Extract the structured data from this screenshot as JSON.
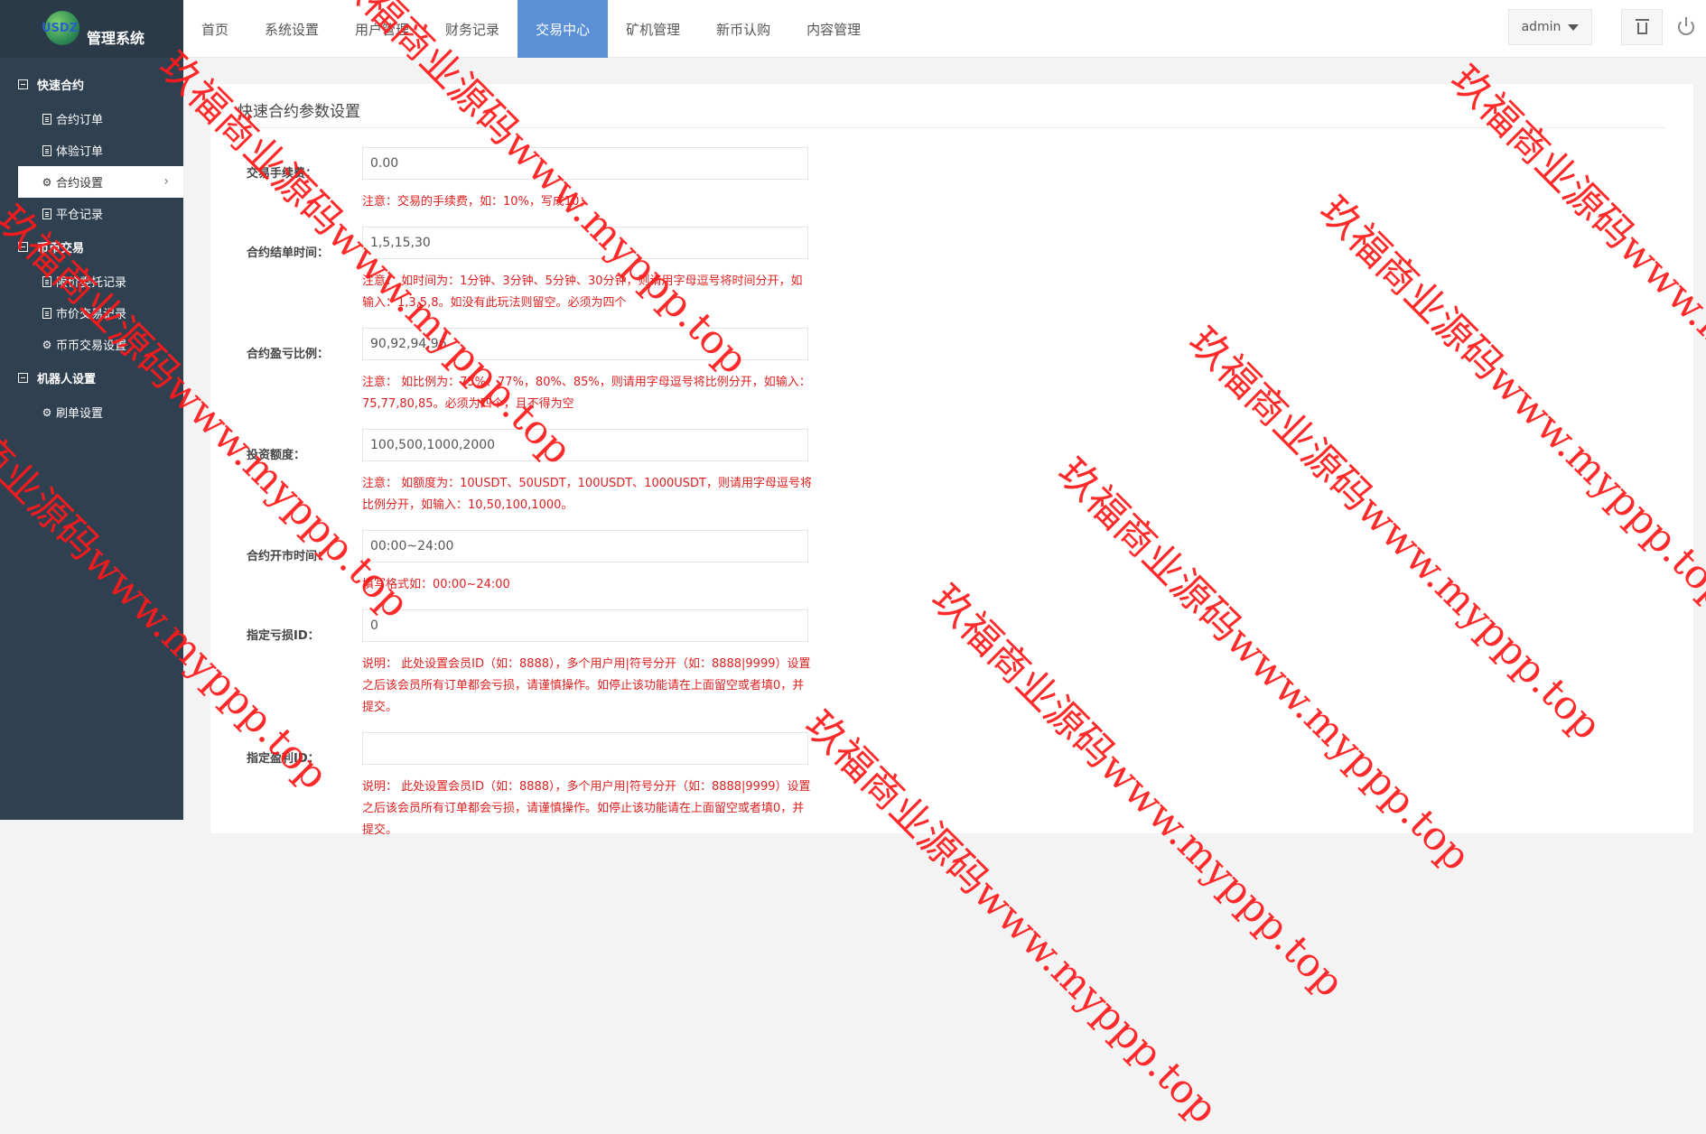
{
  "brand": {
    "logo_mark": "USDZ",
    "title": "管理系统"
  },
  "sidebar": {
    "groups": [
      {
        "title": "快速合约",
        "items": [
          {
            "label": "合约订单",
            "icon": "doc"
          },
          {
            "label": "体验订单",
            "icon": "doc"
          },
          {
            "label": "合约设置",
            "icon": "gear",
            "active": true
          },
          {
            "label": "平仓记录",
            "icon": "doc"
          }
        ]
      },
      {
        "title": "币币交易",
        "items": [
          {
            "label": "限价委托记录",
            "icon": "doc"
          },
          {
            "label": "市价交易记录",
            "icon": "doc"
          },
          {
            "label": "币币交易设置",
            "icon": "gear"
          }
        ]
      },
      {
        "title": "机器人设置",
        "items": [
          {
            "label": "刷单设置",
            "icon": "gear"
          }
        ]
      }
    ]
  },
  "topnav": {
    "items": [
      "首页",
      "系统设置",
      "用户管理",
      "财务记录",
      "交易中心",
      "矿机管理",
      "新币认购",
      "内容管理"
    ],
    "active_index": 4
  },
  "header": {
    "user": "admin"
  },
  "panel": {
    "title": "快速合约参数设置",
    "fields": [
      {
        "label": "交易手续费：",
        "value": "0.00",
        "note": "注意：交易的手续费，如：10%，写成10；"
      },
      {
        "label": "合约结单时间：",
        "value": "1,5,15,30",
        "note": "注意：  如时间为：1分钟、3分钟、5分钟、30分钟，则请用字母逗号将时间分开，如输入：1,3,5,8。如没有此玩法则留空。必须为四个"
      },
      {
        "label": "合约盈亏比例：",
        "value": "90,92,94,96",
        "note": "注意：  如比例为：75%、77%，80%、85%，则请用字母逗号将比例分开，如输入：75,77,80,85。必须为四个，且不得为空"
      },
      {
        "label": "投资额度：",
        "value": "100,500,1000,2000",
        "note": "注意：  如额度为：10USDT、50USDT，100USDT、1000USDT，则请用字母逗号将比例分开，如输入：10,50,100,1000。"
      },
      {
        "label": "合约开市时间：",
        "value": "00:00~24:00",
        "note": "填写格式如：00:00~24:00"
      },
      {
        "label": "指定亏损ID：",
        "value": "0",
        "note": "说明：  此处设置会员ID（如：8888），多个用户用|符号分开（如：8888|9999）设置之后该会员所有订单都会亏损，请谨慎操作。如停止该功能请在上面留空或者填0，并提交。"
      },
      {
        "label": "指定盈利ID：",
        "value": "",
        "note": "说明：  此处设置会员ID（如：8888），多个用户用|符号分开（如：8888|9999）设置之后该会员所有订单都会亏损，请谨慎操作。如停止该功能请在上面留空或者填0，并提交。"
      }
    ]
  },
  "watermark": {
    "text": "玖福商业源码www.myppp.top",
    "color": "#ff1a1a"
  }
}
